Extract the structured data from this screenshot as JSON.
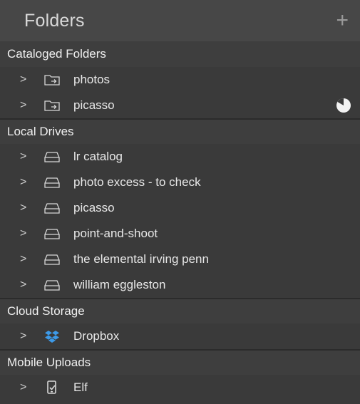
{
  "header": {
    "title": "Folders",
    "add_label": "+"
  },
  "sections": [
    {
      "title": "Cataloged Folders",
      "items": [
        {
          "label": "photos",
          "icon": "cataloged-folder-icon"
        },
        {
          "label": "picasso",
          "icon": "cataloged-folder-icon",
          "status_icon": "sync-progress-icon"
        }
      ]
    },
    {
      "title": "Local Drives",
      "items": [
        {
          "label": "lr catalog",
          "icon": "drive-icon"
        },
        {
          "label": "photo excess - to check",
          "icon": "drive-icon"
        },
        {
          "label": "picasso",
          "icon": "drive-icon"
        },
        {
          "label": "point-and-shoot",
          "icon": "drive-icon"
        },
        {
          "label": "the elemental irving penn",
          "icon": "drive-icon"
        },
        {
          "label": "william eggleston",
          "icon": "drive-icon"
        }
      ]
    },
    {
      "title": "Cloud Storage",
      "items": [
        {
          "label": "Dropbox",
          "icon": "dropbox-icon"
        }
      ]
    },
    {
      "title": "Mobile Uploads",
      "items": [
        {
          "label": "Elf",
          "icon": "mobile-device-icon"
        }
      ]
    }
  ],
  "colors": {
    "panel_bg": "#3a3a3a",
    "header_bg": "#474747",
    "dropbox_blue": "#3d9ae8"
  },
  "chevron": ">"
}
